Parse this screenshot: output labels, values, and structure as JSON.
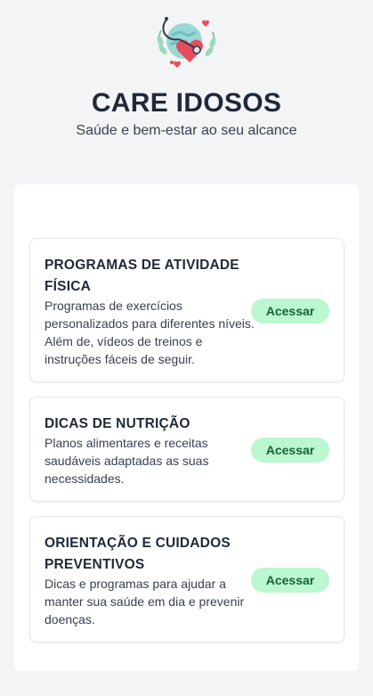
{
  "app": {
    "title": "CARE IDOSOS",
    "subtitle": "Saúde e bem-estar ao seu alcance",
    "logo_icon": "heart-stethoscope-globe-icon"
  },
  "colors": {
    "background": "#f3f4f6",
    "button_bg": "#bbf7d0",
    "button_text": "#166534",
    "title_text": "#1f2937"
  },
  "cards": [
    {
      "title": "PROGRAMAS DE ATIVIDADE FÍSICA",
      "description": "Programas de exercícios personalizados para diferentes níveis. Além de, vídeos de treinos e instruções fáceis de seguir.",
      "button_label": "Acessar"
    },
    {
      "title": "DICAS DE NUTRIÇÃO",
      "description": "Planos alimentares e receitas saudáveis adaptadas as suas necessidades.",
      "button_label": "Acessar"
    },
    {
      "title": "ORIENTAÇÃO E CUIDADOS PREVENTIVOS",
      "description": "Dicas e programas para ajudar a manter sua saúde em dia e prevenir doenças.",
      "button_label": "Acessar"
    }
  ]
}
